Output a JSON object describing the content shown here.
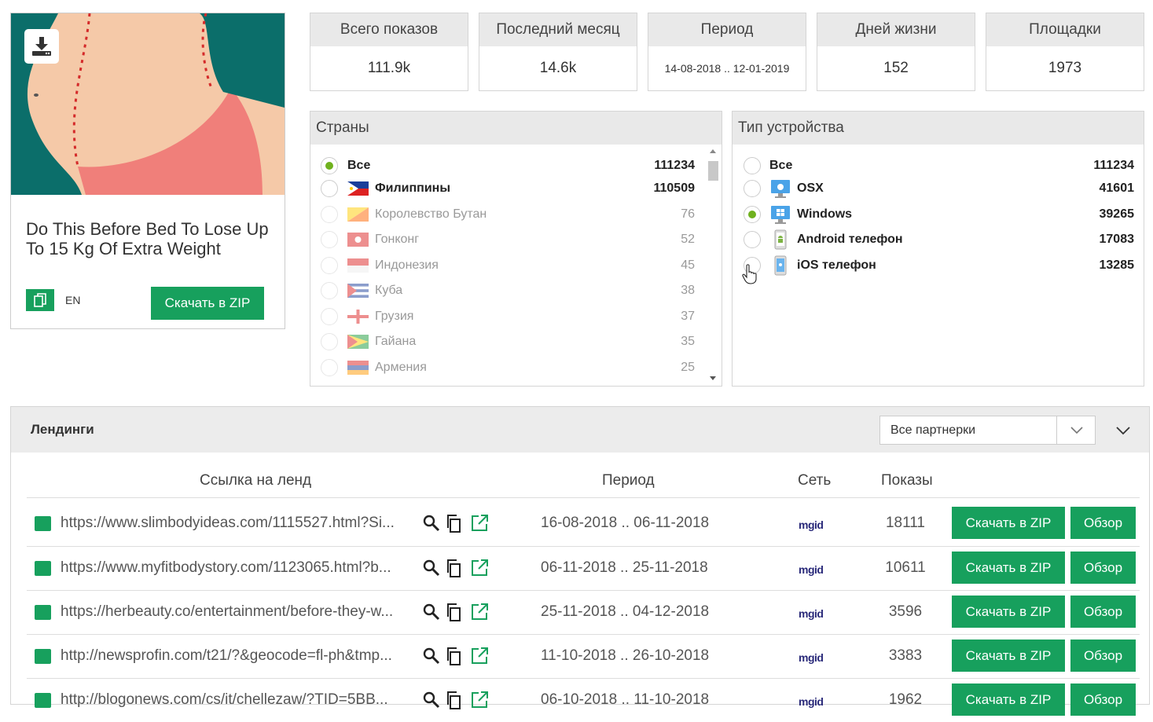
{
  "ad": {
    "title": "Do This Before Bed To Lose Up To 15 Kg Of Extra Weight",
    "lang": "EN",
    "download_label": "Скачать в ZIP"
  },
  "stats": [
    {
      "label": "Всего показов",
      "value": "111.9k"
    },
    {
      "label": "Последний месяц",
      "value": "14.6k"
    },
    {
      "label": "Период",
      "value": "14-08-2018 .. 12-01-2019"
    },
    {
      "label": "Дней жизни",
      "value": "152"
    },
    {
      "label": "Площадки",
      "value": "1973"
    }
  ],
  "countries": {
    "title": "Страны",
    "items": [
      {
        "label": "Все",
        "count": "111234",
        "selected": true,
        "flag": null
      },
      {
        "label": "Филиппины",
        "count": "110509",
        "selected": false,
        "flag": "ph"
      },
      {
        "label": "Королевство Бутан",
        "count": "76",
        "selected": false,
        "flag": "bt"
      },
      {
        "label": "Гонконг",
        "count": "52",
        "selected": false,
        "flag": "hk"
      },
      {
        "label": "Индонезия",
        "count": "45",
        "selected": false,
        "flag": "id"
      },
      {
        "label": "Куба",
        "count": "38",
        "selected": false,
        "flag": "cu"
      },
      {
        "label": "Грузия",
        "count": "37",
        "selected": false,
        "flag": "ge"
      },
      {
        "label": "Гайана",
        "count": "35",
        "selected": false,
        "flag": "gy"
      },
      {
        "label": "Армения",
        "count": "25",
        "selected": false,
        "flag": "am"
      }
    ]
  },
  "devices": {
    "title": "Тип устройства",
    "items": [
      {
        "label": "Все",
        "count": "111234",
        "selected": false,
        "icon": null
      },
      {
        "label": "OSX",
        "count": "41601",
        "selected": false,
        "icon": "apple-monitor-icon"
      },
      {
        "label": "Windows",
        "count": "39265",
        "selected": true,
        "icon": "windows-monitor-icon"
      },
      {
        "label": "Android телефон",
        "count": "17083",
        "selected": false,
        "icon": "android-phone-icon"
      },
      {
        "label": "iOS телефон",
        "count": "13285",
        "selected": false,
        "icon": "ios-phone-icon"
      }
    ]
  },
  "landings": {
    "title": "Лендинги",
    "filter": "Все партнерки",
    "columns": {
      "link": "Ссылка на ленд",
      "period": "Период",
      "network": "Сеть",
      "shows": "Показы"
    },
    "download_label": "Скачать в ZIP",
    "view_label": "Обзор",
    "rows": [
      {
        "url": "https://www.slimbodyideas.com/1115527.html?Si...",
        "period": "16-08-2018 .. 06-11-2018",
        "network": "mgid",
        "shows": "18111"
      },
      {
        "url": "https://www.myfitbodystory.com/1123065.html?b...",
        "period": "06-11-2018 .. 25-11-2018",
        "network": "mgid",
        "shows": "10611"
      },
      {
        "url": "https://herbeauty.co/entertainment/before-they-w...",
        "period": "25-11-2018 .. 04-12-2018",
        "network": "mgid",
        "shows": "3596"
      },
      {
        "url": "http://newsprofin.com/t21/?&geocode=fl-ph&tmp...",
        "period": "11-10-2018 .. 26-10-2018",
        "network": "mgid",
        "shows": "3383"
      },
      {
        "url": "http://blogonews.com/cs/it/chellezaw/?TID=5BB...",
        "period": "06-10-2018 .. 11-10-2018",
        "network": "mgid",
        "shows": "1962"
      }
    ]
  }
}
